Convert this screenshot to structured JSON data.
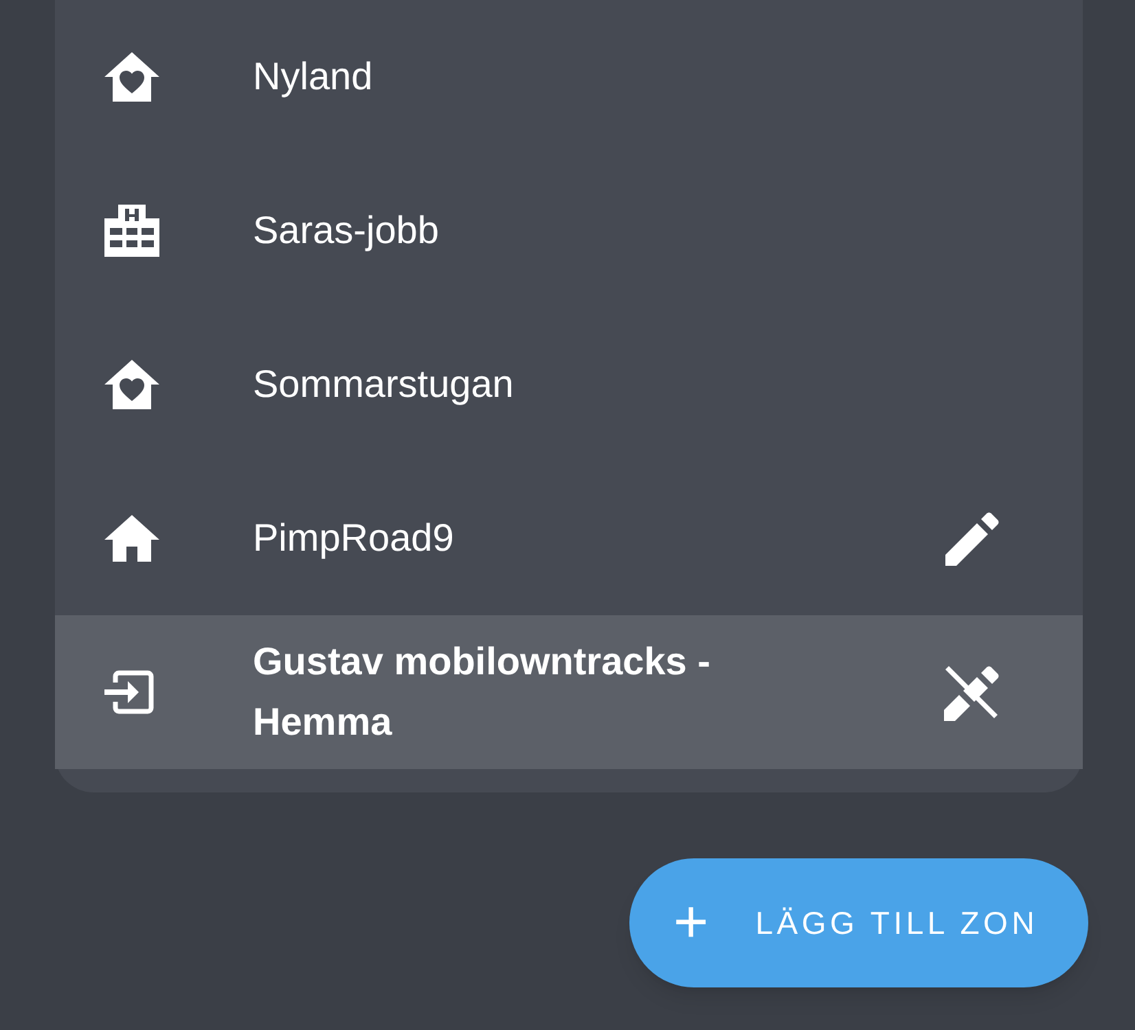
{
  "zones": [
    {
      "kind": "home-heart",
      "label": "Nyland",
      "selected": false
    },
    {
      "kind": "hospital",
      "label": "Saras-jobb",
      "selected": false
    },
    {
      "kind": "home-heart",
      "label": "Sommarstugan",
      "selected": false
    },
    {
      "kind": "home",
      "label": "PimpRoad9",
      "action": {
        "kind": "edit"
      },
      "selected": false
    },
    {
      "kind": "import",
      "label": "Gustav mobilowntracks - Hemma",
      "action": {
        "kind": "edit-off"
      },
      "selected": true
    }
  ],
  "add_button": {
    "icon": "+",
    "label": "LÄGG TILL ZON"
  }
}
